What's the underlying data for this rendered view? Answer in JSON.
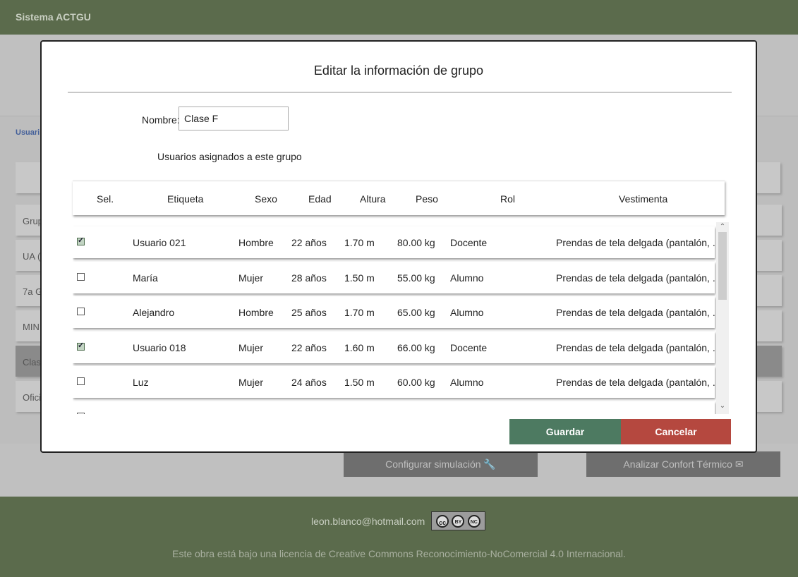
{
  "app": {
    "title": "Sistema ACTGU"
  },
  "background": {
    "breadcrumb": "Usuari",
    "cards": [
      "Grup",
      "UA (",
      "7a G",
      "MIN",
      "Clas",
      "Ofici"
    ],
    "configure_button": "Configurar simulación 🔧",
    "analyze_button": "Analizar Confort Térmico ✉"
  },
  "modal": {
    "title": "Editar la información de grupo",
    "name_label": "Nombre:",
    "name_value": "Clase F",
    "assigned_label": "Usuarios asignados a este grupo",
    "columns": [
      "Sel.",
      "Etiqueta",
      "Sexo",
      "Edad",
      "Altura",
      "Peso",
      "Rol",
      "Vestimenta"
    ],
    "rows": [
      {
        "selected": true,
        "etiqueta": "Usuario 021",
        "sexo": "Hombre",
        "edad": "22 años",
        "altura": "1.70 m",
        "peso": "80.00 kg",
        "rol": "Docente",
        "vestimenta": "Prendas de tela delgada (pantalón, ..."
      },
      {
        "selected": false,
        "etiqueta": "María",
        "sexo": "Mujer",
        "edad": "28 años",
        "altura": "1.50 m",
        "peso": "55.00 kg",
        "rol": "Alumno",
        "vestimenta": "Prendas de tela delgada (pantalón, ..."
      },
      {
        "selected": false,
        "etiqueta": "Alejandro",
        "sexo": "Hombre",
        "edad": "25 años",
        "altura": "1.70 m",
        "peso": "65.00 kg",
        "rol": "Alumno",
        "vestimenta": "Prendas de tela delgada (pantalón, ..."
      },
      {
        "selected": true,
        "etiqueta": "Usuario 018",
        "sexo": "Mujer",
        "edad": "22 años",
        "altura": "1.60 m",
        "peso": "66.00 kg",
        "rol": "Docente",
        "vestimenta": "Prendas de tela delgada (pantalón, ..."
      },
      {
        "selected": false,
        "etiqueta": "Luz",
        "sexo": "Mujer",
        "edad": "24 años",
        "altura": "1.50 m",
        "peso": "60.00 kg",
        "rol": "Alumno",
        "vestimenta": "Prendas de tela delgada (pantalón, ..."
      }
    ],
    "save_label": "Guardar",
    "cancel_label": "Cancelar"
  },
  "footer": {
    "email": "leon.blanco@hotmail.com",
    "license_text": "Este obra está bajo una licencia de Creative Commons Reconocimiento-NoComercial 4.0 Internacional.",
    "cc_badge": {
      "cc": "cc",
      "by": "BY",
      "nc": "NC"
    }
  }
}
